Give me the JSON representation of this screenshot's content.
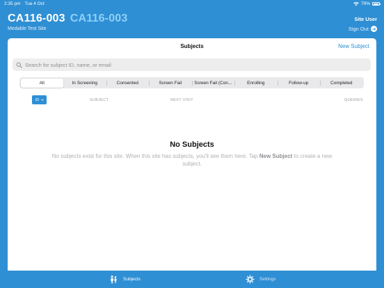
{
  "status_bar": {
    "time": "2:35 pm",
    "date": "Tue 4 Oct",
    "battery": "79%",
    "battery_level": 0.79
  },
  "header": {
    "study_code": "CA116-003",
    "study_code_secondary": "CA116-003",
    "site_name": "Medable Test Site",
    "user": "Site User",
    "sign_out_label": "Sign Out"
  },
  "panel": {
    "title": "Subjects",
    "new_subject_label": "New Subject"
  },
  "search": {
    "placeholder": "Search for subject ID, name, or email",
    "value": ""
  },
  "filters": {
    "selected": "All",
    "items": [
      "All",
      "In Screening",
      "Consented",
      "Screen Fail",
      "Screen Fail (Con...",
      "Enrolling",
      "Follow-up",
      "Completed"
    ]
  },
  "columns": {
    "sort_label": "ID",
    "subject": "SUBJECT",
    "next_visit": "NEXT VISIT",
    "queries": "QUERIES"
  },
  "empty_state": {
    "title": "No Subjects",
    "text_before": "No subjects exist for this site. When this site has subjects, you'll see them here. Tap ",
    "text_bold": "New Subject",
    "text_after": " to create a new subject."
  },
  "tab_bar": {
    "selected": "Subjects",
    "tabs": [
      {
        "label": "Subjects",
        "icon": "people-icon"
      },
      {
        "label": "Settings",
        "icon": "gear-icon"
      }
    ]
  },
  "colors": {
    "brand_blue": "#2f8fd4",
    "secondary_title": "#8fd0f7"
  }
}
